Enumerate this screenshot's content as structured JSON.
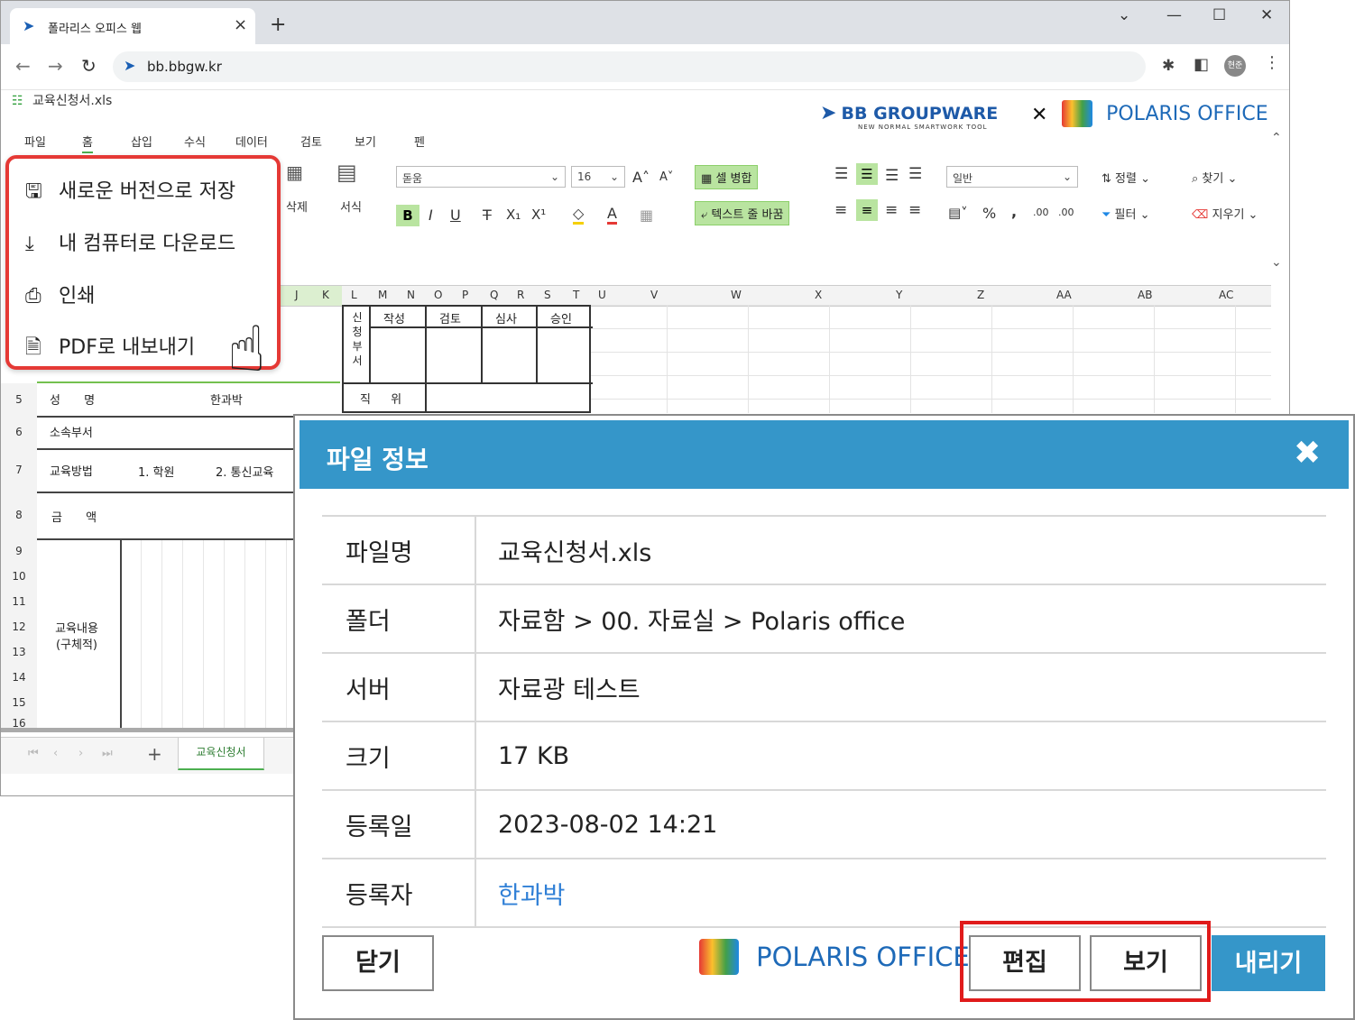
{
  "browser": {
    "tab_title": "폴라리스 오피스 웹",
    "url": "bb.bbgw.kr",
    "profile": "현준"
  },
  "office": {
    "file_name": "교육신청서.xls",
    "menus": [
      "파일",
      "홈",
      "삽입",
      "수식",
      "데이터",
      "검토",
      "보기",
      "펜"
    ],
    "ribbon": {
      "delete": "삭제",
      "format": "서식",
      "font": "돋움",
      "font_size": "16",
      "merge": "셀 병합",
      "wrap": "텍스트 줄 바꿈",
      "number_format": "일반",
      "sort": "정렬",
      "filter": "필터",
      "find": "찾기",
      "clear": "지우기"
    },
    "columns": [
      "J",
      "K",
      "L",
      "M",
      "N",
      "O",
      "P",
      "Q",
      "R",
      "S",
      "T",
      "U",
      "V",
      "W",
      "X",
      "Y",
      "Z",
      "AA",
      "AB",
      "AC"
    ],
    "rows": [
      "5",
      "6",
      "7",
      "8",
      "9",
      "10",
      "11",
      "12",
      "13",
      "14",
      "15",
      "16"
    ],
    "cells": {
      "applicant_dept": "신청부서",
      "write": "작성",
      "review": "검토",
      "audit": "심사",
      "approve": "승인",
      "name_label": "성 명",
      "name_value": "한과박",
      "position": "직 위",
      "dept_label": "소속부서",
      "method_label": "교육방법",
      "method_1": "1. 학원",
      "method_2": "2. 통신교육",
      "amount_label": "금 액",
      "content_label": "교육내용(구체적)"
    },
    "sheet_tab": "교육신청서"
  },
  "brand": {
    "bb": "BB GROUPWARE",
    "bb_sub": "NEW NORMAL SMARTWORK TOOL",
    "x": "✕",
    "polaris": "POLARIS OFFICE"
  },
  "file_menu": {
    "items": [
      "새로운 버전으로 저장",
      "내 컴퓨터로 다운로드",
      "인쇄",
      "PDF로 내보내기"
    ]
  },
  "dialog": {
    "title": "파일 정보",
    "rows": [
      {
        "key": "파일명",
        "value": "교육신청서.xls"
      },
      {
        "key": "폴더",
        "value": "자료함 > 00. 자료실 > Polaris office"
      },
      {
        "key": "서버",
        "value": "자료광 테스트"
      },
      {
        "key": "크기",
        "value": "17 KB"
      },
      {
        "key": "등록일",
        "value": "2023-08-02 14:21"
      },
      {
        "key": "등록자",
        "value": "한과박"
      }
    ],
    "close_button": "닫기",
    "edit_button": "편집",
    "view_button": "보기",
    "download_button": "내리기",
    "brand": "POLARIS OFFICE"
  },
  "colors": {
    "dialog_header": "#3596c9",
    "highlight_red": "#e01b1b",
    "link_blue": "#2f7fd6"
  }
}
